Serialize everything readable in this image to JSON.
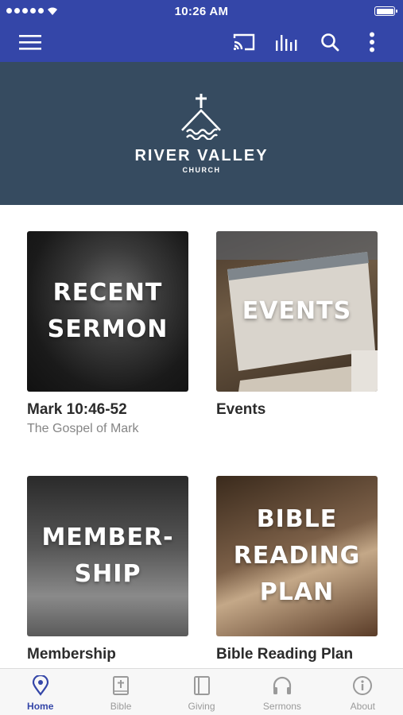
{
  "status_bar": {
    "time": "10:26 AM"
  },
  "banner": {
    "church_name": "RIVER VALLEY",
    "church_subtitle": "CHURCH"
  },
  "cards": [
    {
      "image_text_line1": "RECENT",
      "image_text_line2": "SERMON",
      "title": "Mark 10:46-52",
      "subtitle": "The Gospel of Mark"
    },
    {
      "image_text_line1": "EVENTS",
      "image_text_line2": "",
      "title": "Events",
      "subtitle": ""
    },
    {
      "image_text_line1": "MEMBER-",
      "image_text_line2": "SHIP",
      "title": "Membership",
      "subtitle": ""
    },
    {
      "image_text_line1": "BIBLE",
      "image_text_line2": "READING",
      "image_text_line3": "PLAN",
      "title": "Bible Reading Plan",
      "subtitle": ""
    }
  ],
  "bottom_nav": [
    {
      "label": "Home",
      "icon": "location-pin-icon",
      "active": true
    },
    {
      "label": "Bible",
      "icon": "bible-icon",
      "active": false
    },
    {
      "label": "Giving",
      "icon": "giving-icon",
      "active": false
    },
    {
      "label": "Sermons",
      "icon": "headphones-icon",
      "active": false
    },
    {
      "label": "About",
      "icon": "info-icon",
      "active": false
    }
  ],
  "colors": {
    "primary": "#3446a8",
    "banner": "#364b60",
    "inactive": "#9a9a9a"
  }
}
